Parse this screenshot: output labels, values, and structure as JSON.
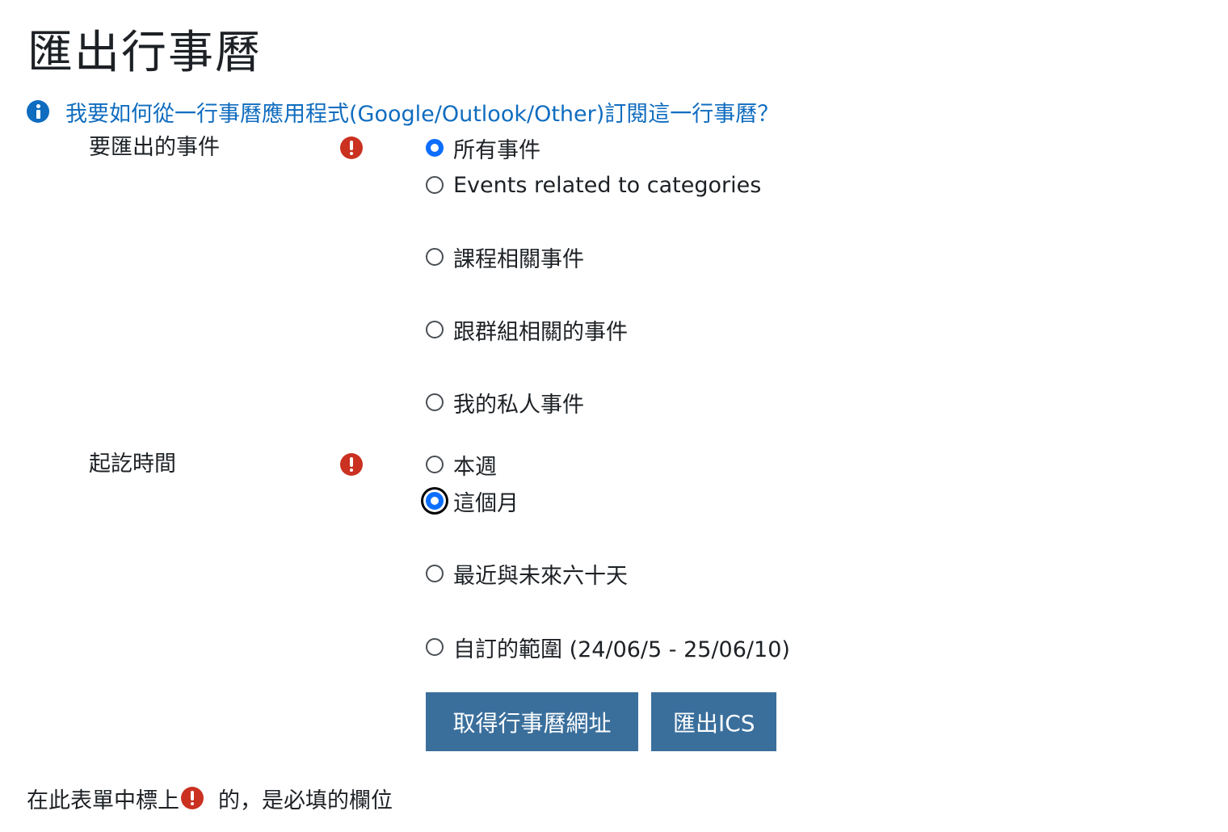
{
  "page": {
    "title": "匯出行事曆"
  },
  "help": {
    "icon": "info-circle-icon",
    "link_text": "我要如何從一行事曆應用程式(Google/Outlook/Other)訂閱這一行事曆？"
  },
  "form": {
    "events": {
      "label": "要匯出的事件",
      "required_icon": "exclamation-circle-icon",
      "options": [
        {
          "label": "所有事件",
          "checked": true
        },
        {
          "label": "Events related to categories",
          "checked": false
        },
        {
          "label": "課程相關事件",
          "checked": false
        },
        {
          "label": "跟群組相關的事件",
          "checked": false
        },
        {
          "label": "我的私人事件",
          "checked": false
        }
      ]
    },
    "timeperiod": {
      "label": "起訖時間",
      "required_icon": "exclamation-circle-icon",
      "options": [
        {
          "label": "本週",
          "checked": false
        },
        {
          "label": "這個月",
          "checked": true,
          "focused": true
        },
        {
          "label": "最近與未來六十天",
          "checked": false
        },
        {
          "label": "自訂的範圍 (24/06/5 - 25/06/10)",
          "checked": false
        }
      ]
    },
    "buttons": {
      "get_url": "取得行事曆網址",
      "export_ics": "匯出ICS"
    }
  },
  "footer": {
    "required_note_before": "在此表單中標上",
    "required_note_after": "的，是必填的欄位"
  },
  "colors": {
    "link": "#0f6cbf",
    "required": "#ca3120",
    "radio_checked": "#0d6efd",
    "button": "#3a6f9c"
  }
}
